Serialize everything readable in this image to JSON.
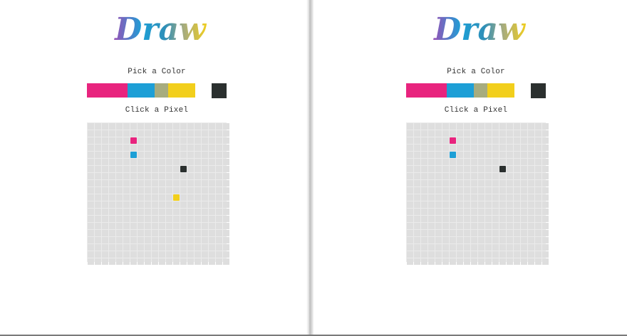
{
  "app": {
    "logo_text": "Draw",
    "pick_label": "Pick a Color",
    "click_label": "Click a Pixel"
  },
  "colors": {
    "empty": "#dedede",
    "grid_lines": "#ebebeb"
  },
  "palette": [
    {
      "name": "pink",
      "hex": "#e8247e"
    },
    {
      "name": "pink",
      "hex": "#e8247e"
    },
    {
      "name": "pink",
      "hex": "#e8247e"
    },
    {
      "name": "blue",
      "hex": "#1d9fd6"
    },
    {
      "name": "blue",
      "hex": "#1d9fd6"
    },
    {
      "name": "olive",
      "hex": "#a7ac7e"
    },
    {
      "name": "yellow",
      "hex": "#f2cf1c"
    },
    {
      "name": "yellow",
      "hex": "#f2cf1c"
    },
    {
      "name": "dark",
      "hex": "#2b302f",
      "selected": true
    }
  ],
  "grid": {
    "rows": 20,
    "cols": 20
  },
  "panes": [
    {
      "id": "left",
      "pixels": [
        {
          "row": 2,
          "col": 6,
          "color": "#e8247e"
        },
        {
          "row": 4,
          "col": 6,
          "color": "#1d9fd6"
        },
        {
          "row": 6,
          "col": 13,
          "color": "#2b302f"
        },
        {
          "row": 10,
          "col": 12,
          "color": "#f2cf1c"
        }
      ]
    },
    {
      "id": "right",
      "pixels": [
        {
          "row": 2,
          "col": 6,
          "color": "#e8247e"
        },
        {
          "row": 4,
          "col": 6,
          "color": "#1d9fd6"
        },
        {
          "row": 6,
          "col": 13,
          "color": "#2b302f"
        }
      ]
    }
  ]
}
